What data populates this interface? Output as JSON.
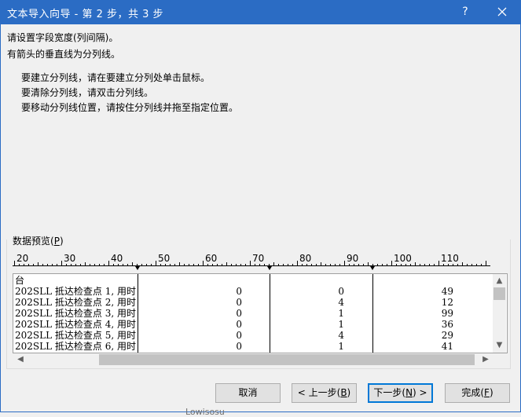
{
  "window": {
    "title": "文本导入向导 - 第 2 步，共 3 步",
    "help_label": "?",
    "title_color": "#2b6cc4"
  },
  "instructions": {
    "line1": "请设置字段宽度(列间隔)。",
    "line2": "有箭头的垂直线为分列线。",
    "bullets": [
      "要建立分列线，请在要建立分列处单击鼠标。",
      "要清除分列线，请双击分列线。",
      "要移动分列线位置，请按住分列线并拖至指定位置。"
    ]
  },
  "preview": {
    "label_prefix": "数据预览(",
    "label_key": "P",
    "label_suffix": ")",
    "ruler_labels": [
      "20",
      "30",
      "40",
      "50",
      "60",
      "70",
      "80",
      "90",
      "100",
      "110"
    ],
    "first_row": "台",
    "rows": [
      {
        "name": "202SLL 抵达检查点 1, 用时",
        "c1": "0",
        "c2": "0",
        "c3": "49"
      },
      {
        "name": "202SLL 抵达检查点 2, 用时",
        "c1": "0",
        "c2": "4",
        "c3": "12"
      },
      {
        "name": "202SLL 抵达检查点 3, 用时",
        "c1": "0",
        "c2": "1",
        "c3": "99"
      },
      {
        "name": "202SLL 抵达检查点 4, 用时",
        "c1": "0",
        "c2": "1",
        "c3": "36"
      },
      {
        "name": "202SLL 抵达检查点 5, 用时",
        "c1": "0",
        "c2": "4",
        "c3": "29"
      },
      {
        "name": "202SLL 抵达检查点 6, 用时",
        "c1": "0",
        "c2": "1",
        "c3": "41"
      }
    ]
  },
  "buttons": {
    "cancel": "取消",
    "back_prefix": "< 上一步(",
    "back_key": "B",
    "back_suffix": ")",
    "next_prefix": "下一步(",
    "next_key": "N",
    "next_suffix": ") >",
    "finish_prefix": "完成(",
    "finish_key": "F",
    "finish_suffix": ")"
  },
  "background_text": "Lowisosu",
  "icons": {
    "close": "close-icon",
    "up": "chevron-up-icon",
    "down": "chevron-down-icon",
    "left": "chevron-left-icon",
    "right": "chevron-right-icon"
  }
}
